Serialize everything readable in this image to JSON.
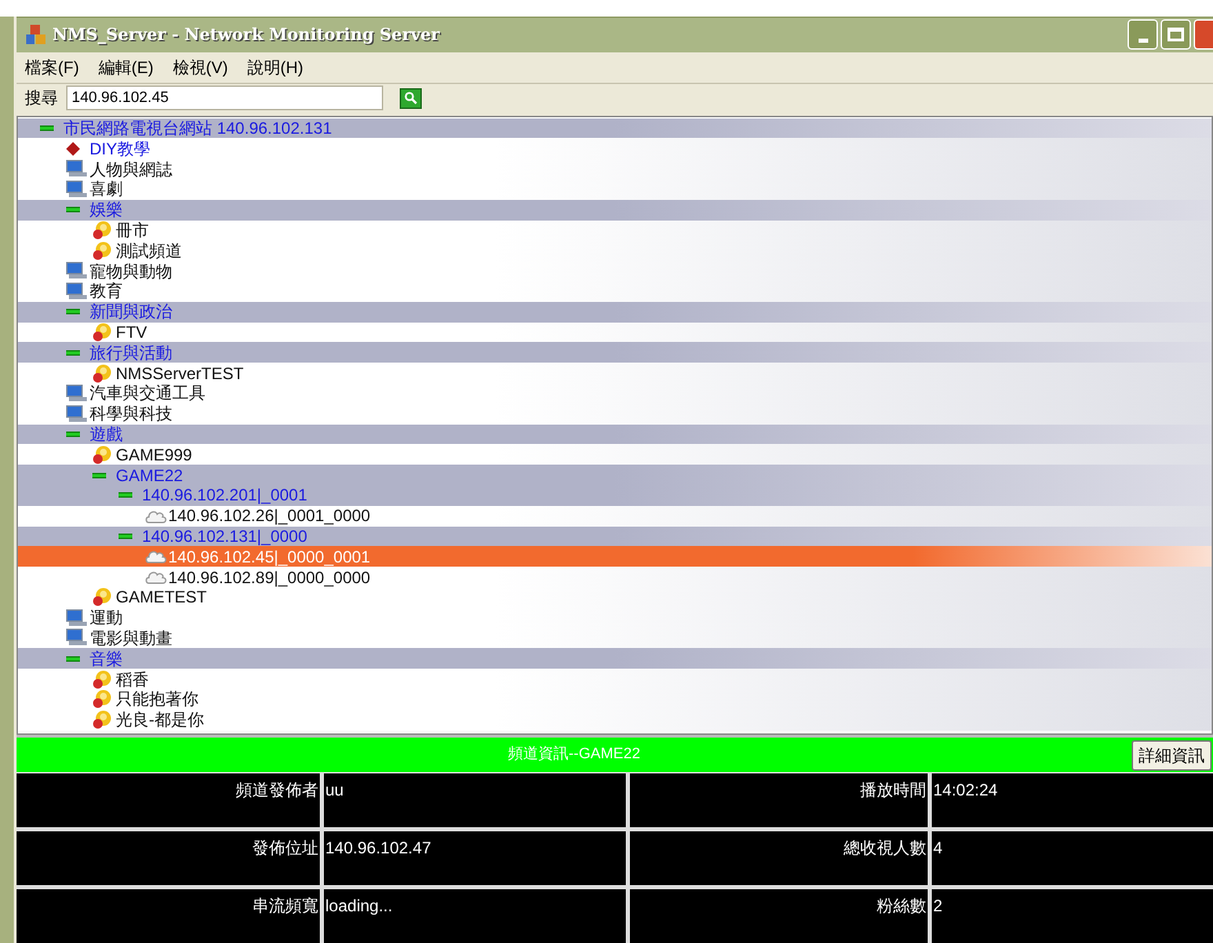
{
  "window": {
    "title": "NMS_Server - Network Monitoring Server"
  },
  "menu": [
    "檔案(F)",
    "編輯(E)",
    "檢視(V)",
    "說明(H)"
  ],
  "search": {
    "label": "搜尋",
    "value": "140.96.102.45"
  },
  "tree": [
    {
      "label": "市民網路電視台網站 140.96.102.131",
      "kind": "group",
      "expanded": true,
      "selected": false,
      "children": [
        {
          "label": "DIY教學",
          "kind": "special",
          "selected": false
        },
        {
          "label": "人物與網誌",
          "kind": "category",
          "selected": false
        },
        {
          "label": "喜劇",
          "kind": "category",
          "selected": false
        },
        {
          "label": "娛樂",
          "kind": "group",
          "expanded": true,
          "selected": false,
          "children": [
            {
              "label": "冊市",
              "kind": "channel",
              "selected": false
            },
            {
              "label": "測試頻道",
              "kind": "channel",
              "selected": false
            }
          ]
        },
        {
          "label": "寵物與動物",
          "kind": "category",
          "selected": false
        },
        {
          "label": "教育",
          "kind": "category",
          "selected": false
        },
        {
          "label": "新聞與政治",
          "kind": "group",
          "expanded": true,
          "selected": false,
          "children": [
            {
              "label": "FTV",
              "kind": "channel",
              "selected": false
            }
          ]
        },
        {
          "label": "旅行與活動",
          "kind": "group",
          "expanded": true,
          "selected": false,
          "children": [
            {
              "label": "NMSServerTEST",
              "kind": "channel",
              "selected": false
            }
          ]
        },
        {
          "label": "汽車與交通工具",
          "kind": "category",
          "selected": false
        },
        {
          "label": "科學與科技",
          "kind": "category",
          "selected": false
        },
        {
          "label": "遊戲",
          "kind": "group",
          "expanded": true,
          "selected": false,
          "children": [
            {
              "label": "GAME999",
              "kind": "channel",
              "selected": false
            },
            {
              "label": "GAME22",
              "kind": "group",
              "expanded": true,
              "selected": false,
              "children": [
                {
                  "label": "140.96.102.201|_0001",
                  "kind": "group",
                  "expanded": true,
                  "selected": false,
                  "children": [
                    {
                      "label": "140.96.102.26|_0001_0000",
                      "kind": "stream",
                      "selected": false
                    }
                  ]
                },
                {
                  "label": "140.96.102.131|_0000",
                  "kind": "group",
                  "expanded": true,
                  "selected": false,
                  "children": [
                    {
                      "label": "140.96.102.45|_0000_0001",
                      "kind": "stream",
                      "selected": true
                    },
                    {
                      "label": "140.96.102.89|_0000_0000",
                      "kind": "stream",
                      "selected": false
                    }
                  ]
                }
              ]
            },
            {
              "label": "GAMETEST",
              "kind": "channel",
              "selected": false
            }
          ]
        },
        {
          "label": "運動",
          "kind": "category",
          "selected": false
        },
        {
          "label": "電影與動畫",
          "kind": "category",
          "selected": false
        },
        {
          "label": "音樂",
          "kind": "group",
          "expanded": true,
          "selected": false,
          "children": [
            {
              "label": "稻香",
              "kind": "channel",
              "selected": false
            },
            {
              "label": "只能抱著你",
              "kind": "channel",
              "selected": false
            },
            {
              "label": "光良-都是你",
              "kind": "channel",
              "selected": false
            }
          ]
        }
      ]
    }
  ],
  "info_bar": {
    "title": "頻道資訊--GAME22",
    "button": "詳細資訊"
  },
  "info_table": [
    [
      {
        "label": "頻道發佈者",
        "value": "uu"
      },
      {
        "label": "播放時間",
        "value": "14:02:24"
      }
    ],
    [
      {
        "label": "發佈位址",
        "value": "140.96.102.47"
      },
      {
        "label": "總收視人數",
        "value": "4"
      }
    ],
    [
      {
        "label": "串流頻寬",
        "value": "loading..."
      },
      {
        "label": "粉絲數",
        "value": "2"
      }
    ]
  ]
}
